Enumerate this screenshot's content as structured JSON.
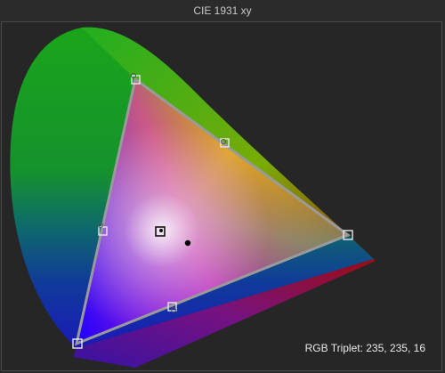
{
  "window": {
    "title": "CIE 1931 xy"
  },
  "readout": {
    "text": "RGB Triplet: 235, 235, 16"
  },
  "colors": {
    "background": "#2b2b2b",
    "plot_background": "#262626",
    "gamut_outline": "#9a9a9a",
    "marker_outline": "#e8e8e8",
    "current_point": "#000000"
  }
}
